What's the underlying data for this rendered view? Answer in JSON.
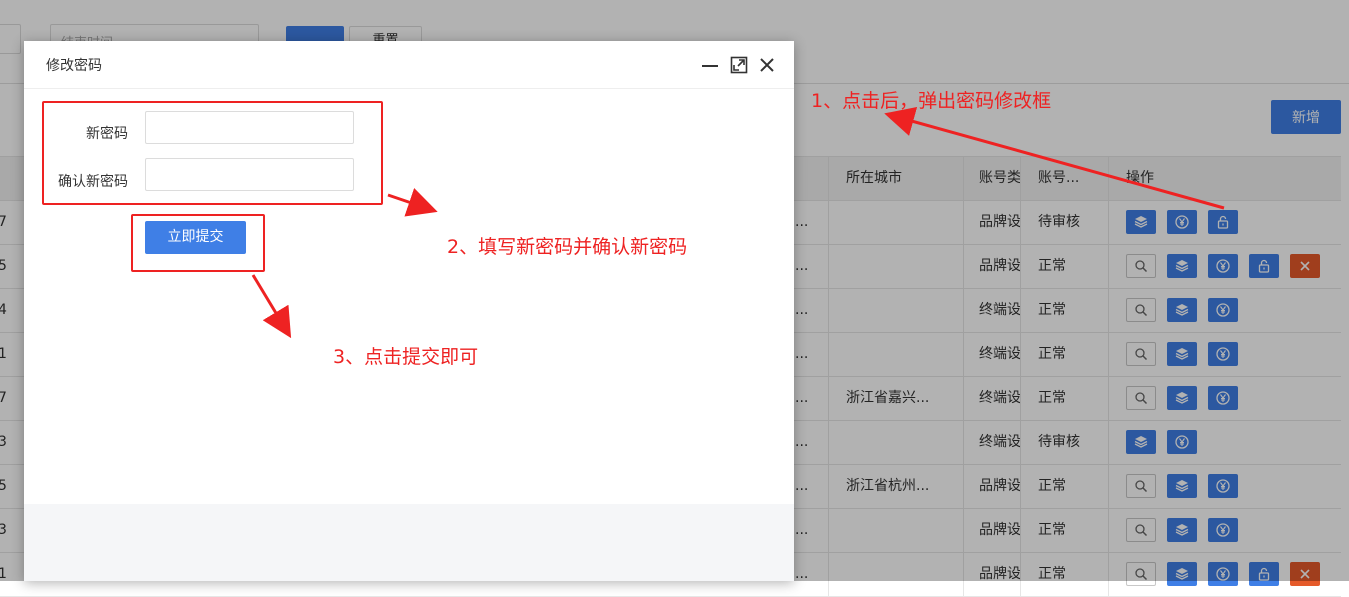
{
  "filter": {
    "end_time_placeholder": "结束时间",
    "reset_label": "重置"
  },
  "toolbar": {
    "add_label": "新增"
  },
  "table": {
    "headers": {
      "city": "所在城市",
      "account_type": "账号类",
      "account_status": "账号...",
      "actions": "操作"
    },
    "rows": [
      {
        "num": "7",
        "mid": "...",
        "city": "",
        "type": "品牌设",
        "status": "待审核",
        "ops": [
          "layers",
          "yen",
          "unlock"
        ]
      },
      {
        "num": "5",
        "mid": "...",
        "city": "",
        "type": "品牌设",
        "status": "正常",
        "ops": [
          "view",
          "layers",
          "yen",
          "unlock",
          "delete"
        ]
      },
      {
        "num": "4",
        "mid": "...",
        "city": "",
        "type": "终端设",
        "status": "正常",
        "ops": [
          "view",
          "layers",
          "yen"
        ]
      },
      {
        "num": "1",
        "mid": "...",
        "city": "",
        "type": "终端设",
        "status": "正常",
        "ops": [
          "view",
          "layers",
          "yen"
        ]
      },
      {
        "num": "7",
        "mid": "...",
        "city": "浙江省嘉兴...",
        "type": "终端设",
        "status": "正常",
        "ops": [
          "view",
          "layers",
          "yen"
        ]
      },
      {
        "num": "3",
        "mid": "...",
        "city": "",
        "type": "终端设",
        "status": "待审核",
        "ops": [
          "layers",
          "yen"
        ]
      },
      {
        "num": "5",
        "mid": "...",
        "city": "浙江省杭州...",
        "type": "品牌设",
        "status": "正常",
        "ops": [
          "view",
          "layers",
          "yen"
        ]
      },
      {
        "num": "3",
        "mid": "...",
        "city": "",
        "type": "品牌设",
        "status": "正常",
        "ops": [
          "view",
          "layers",
          "yen"
        ]
      },
      {
        "num": "1",
        "mid": "...",
        "city": "",
        "type": "品牌设",
        "status": "正常",
        "ops": [
          "view",
          "layers",
          "yen",
          "unlock",
          "delete"
        ]
      }
    ]
  },
  "modal": {
    "title": "修改密码",
    "new_password_label": "新密码",
    "confirm_password_label": "确认新密码",
    "new_password_value": "",
    "confirm_password_value": "",
    "submit_label": "立即提交"
  },
  "annotations": {
    "step1": "1、点击后，弹出密码修改框",
    "step2": "2、填写新密码并确认新密码",
    "step3": "3、点击提交即可"
  },
  "colors": {
    "primary": "#3f7fe6",
    "danger": "#e55a2a",
    "annotation": "#ee2222"
  }
}
